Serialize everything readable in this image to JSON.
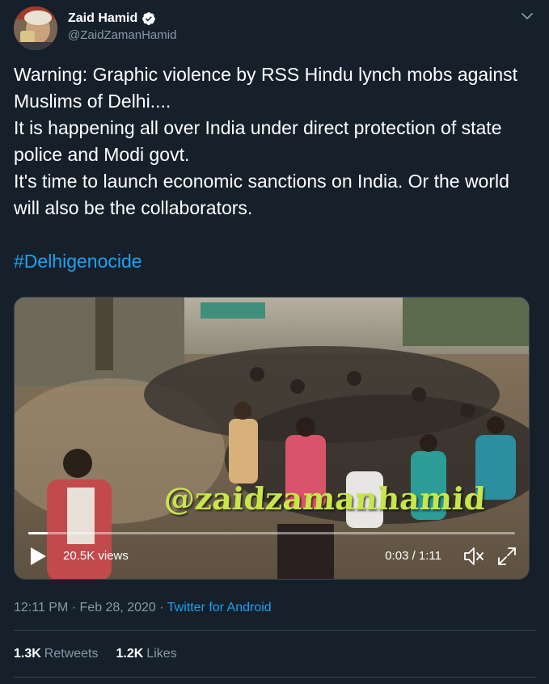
{
  "author": {
    "display_name": "Zaid Hamid",
    "handle": "@ZaidZamanHamid",
    "verified": true
  },
  "tweet": {
    "text": "Warning: Graphic violence by RSS Hindu lynch mobs against Muslims of Delhi....\nIt is happening all over India under direct protection of state police and Modi govt.\nIt's time to launch economic sanctions on India. Or the world will also be the collaborators.",
    "hashtag": "#Delhigenocide"
  },
  "video": {
    "watermark": "@zaidzamanhamid",
    "views": "20.5K views",
    "timecode": "0:03 / 1:11",
    "progress_fraction": 0.04
  },
  "meta": {
    "time": "12:11 PM",
    "separator1": " · ",
    "date": "Feb 28, 2020",
    "separator2": " · ",
    "source": "Twitter for Android"
  },
  "stats": {
    "retweets_count": "1.3K",
    "retweets_label": "Retweets",
    "likes_count": "1.2K",
    "likes_label": "Likes"
  },
  "colors": {
    "background": "#15202b",
    "link": "#1da1f2",
    "secondary_text": "#8899a6",
    "divider": "#38444d"
  },
  "icons": {
    "verified": "verified-badge-icon",
    "more": "chevron-down-icon",
    "play": "play-icon",
    "mute": "volume-muted-icon",
    "fullscreen": "fullscreen-icon"
  }
}
